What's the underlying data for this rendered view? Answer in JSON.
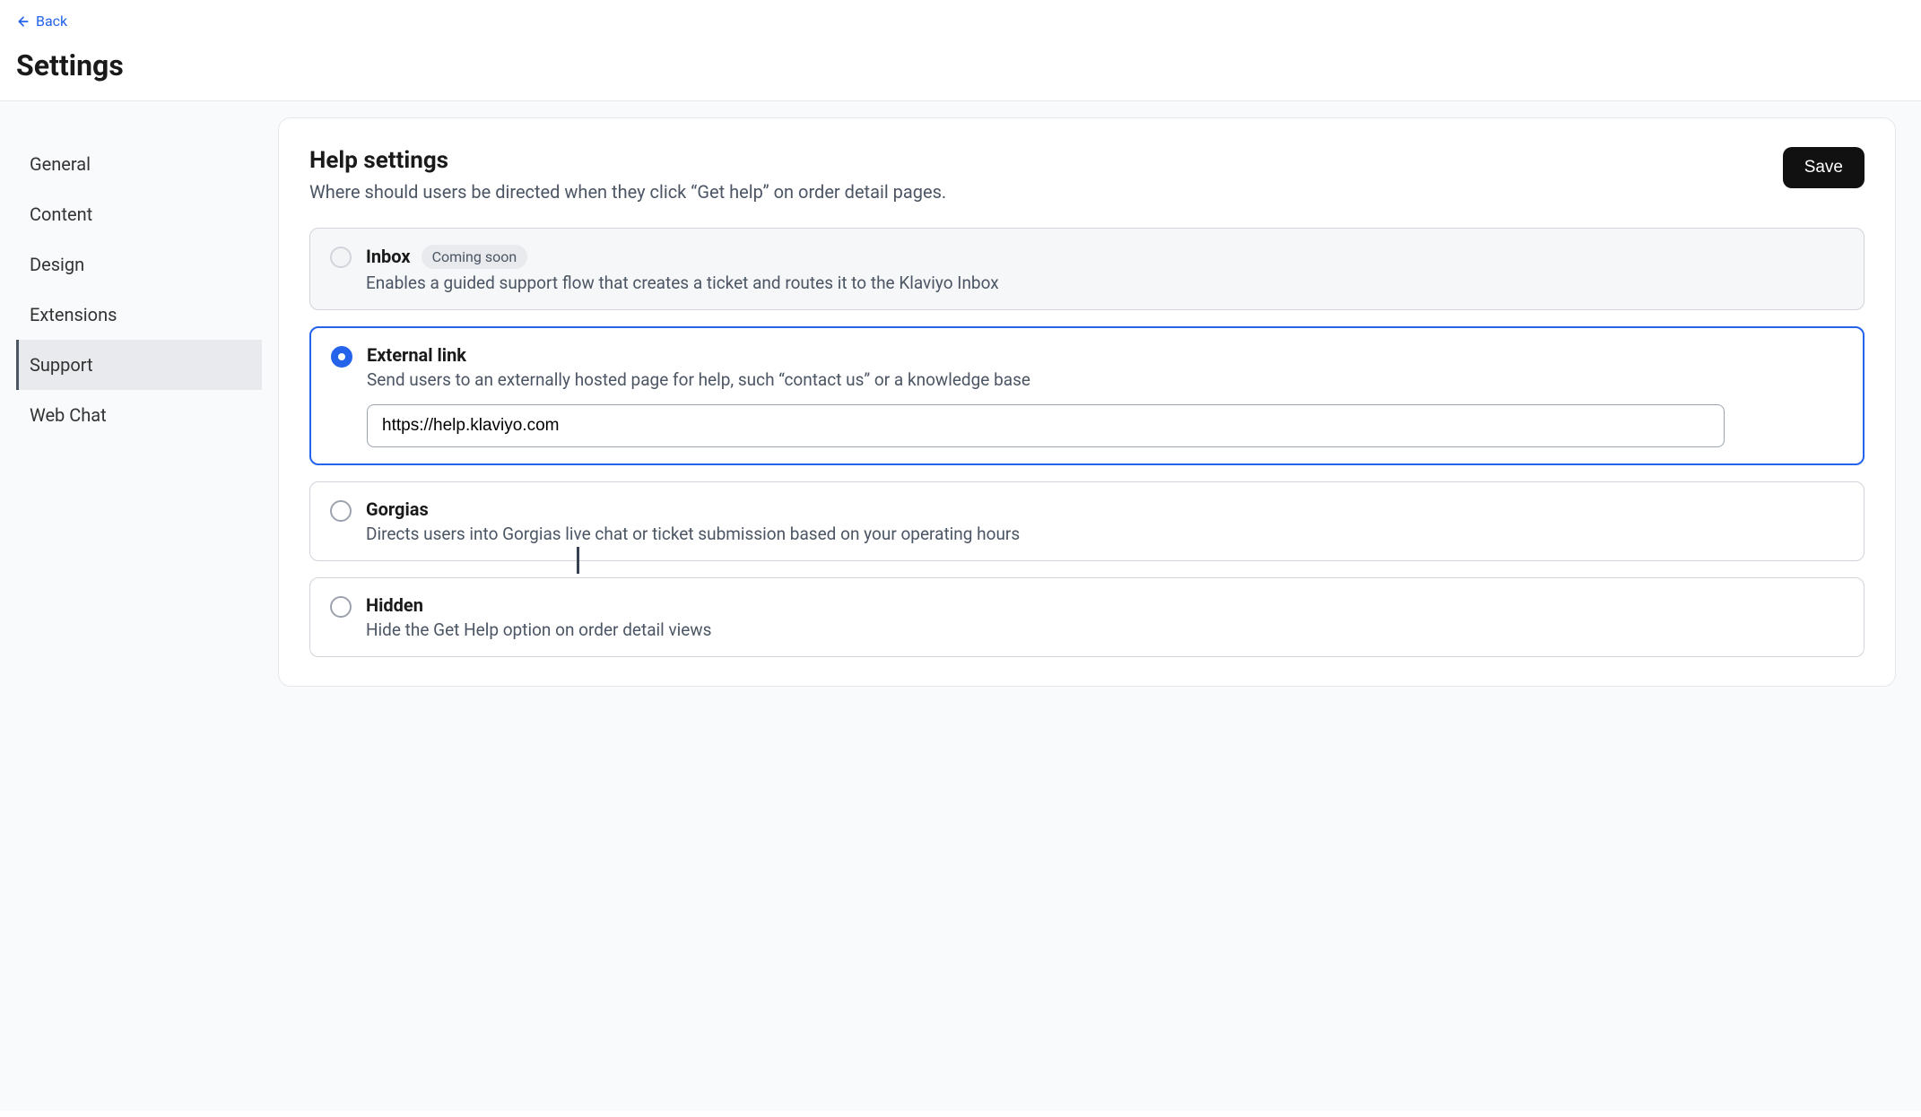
{
  "header": {
    "back_label": "Back",
    "page_title": "Settings"
  },
  "sidebar": {
    "items": [
      {
        "label": "General",
        "active": false
      },
      {
        "label": "Content",
        "active": false
      },
      {
        "label": "Design",
        "active": false
      },
      {
        "label": "Extensions",
        "active": false
      },
      {
        "label": "Support",
        "active": true
      },
      {
        "label": "Web Chat",
        "active": false
      }
    ]
  },
  "panel": {
    "title": "Help settings",
    "subtitle": "Where should users be directed when they click “Get help” on order detail pages.",
    "save_label": "Save"
  },
  "options": {
    "inbox": {
      "title": "Inbox",
      "badge": "Coming soon",
      "desc": "Enables a guided support flow that creates a ticket and routes it to the Klaviyo Inbox"
    },
    "external": {
      "title": "External link",
      "desc": "Send users to an externally hosted page for help, such “contact us” or a knowledge base",
      "url_value": "https://help.klaviyo.com"
    },
    "gorgias": {
      "title": "Gorgias",
      "desc": "Directs users into Gorgias live chat or ticket submission based on your operating hours"
    },
    "hidden": {
      "title": "Hidden",
      "desc": "Hide the Get Help option on order detail views"
    }
  }
}
